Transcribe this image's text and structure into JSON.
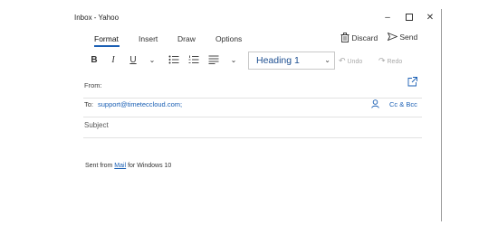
{
  "window": {
    "title": "Inbox - Yahoo",
    "minimize": "–",
    "close": "✕"
  },
  "tabs": [
    {
      "label": "Format",
      "active": true
    },
    {
      "label": "Insert"
    },
    {
      "label": "Draw"
    },
    {
      "label": "Options"
    }
  ],
  "actions": {
    "discard_label": "Discard",
    "send_label": "Send"
  },
  "toolbar": {
    "bold": "B",
    "italic": "I",
    "underline": "U",
    "style_value": "Heading 1",
    "undo_label": "Undo",
    "redo_label": "Redo"
  },
  "compose": {
    "from_label": "From:",
    "to_label": "To:",
    "to_value": "support@timeteccloud.com;",
    "cc_label": "Cc & Bcc",
    "subject_label": "Subject"
  },
  "signature": {
    "prefix": "Sent from ",
    "link": "Mail",
    "suffix": " for Windows 10"
  },
  "colors": {
    "accent": "#1a5fb4"
  }
}
